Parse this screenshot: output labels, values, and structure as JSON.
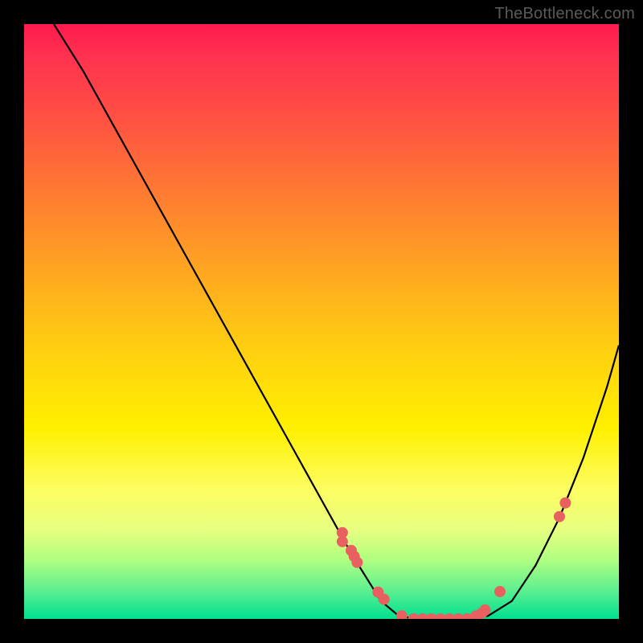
{
  "watermark": "TheBottleneck.com",
  "chart_data": {
    "type": "line",
    "title": "",
    "xlabel": "",
    "ylabel": "",
    "xlim": [
      0,
      1
    ],
    "ylim": [
      0,
      1
    ],
    "series": [
      {
        "name": "curve",
        "x": [
          0.05,
          0.1,
          0.15,
          0.2,
          0.25,
          0.3,
          0.35,
          0.4,
          0.45,
          0.5,
          0.55,
          0.6,
          0.63,
          0.66,
          0.7,
          0.74,
          0.78,
          0.82,
          0.86,
          0.9,
          0.94,
          0.98,
          1.0
        ],
        "y": [
          1.0,
          0.92,
          0.83,
          0.74,
          0.65,
          0.56,
          0.47,
          0.38,
          0.29,
          0.2,
          0.11,
          0.03,
          0.005,
          0.0,
          0.0,
          0.0,
          0.005,
          0.03,
          0.09,
          0.17,
          0.27,
          0.39,
          0.46
        ]
      }
    ],
    "markers": {
      "name": "highlighted-points",
      "x": [
        0.535,
        0.535,
        0.55,
        0.555,
        0.56,
        0.595,
        0.605,
        0.635,
        0.655,
        0.67,
        0.685,
        0.7,
        0.715,
        0.73,
        0.745,
        0.76,
        0.77,
        0.775,
        0.8,
        0.9,
        0.91
      ],
      "y": [
        0.145,
        0.13,
        0.115,
        0.105,
        0.095,
        0.045,
        0.033,
        0.005,
        0.0,
        0.0,
        0.0,
        0.0,
        0.0,
        0.0,
        0.0,
        0.005,
        0.01,
        0.015,
        0.046,
        0.172,
        0.195
      ]
    }
  }
}
